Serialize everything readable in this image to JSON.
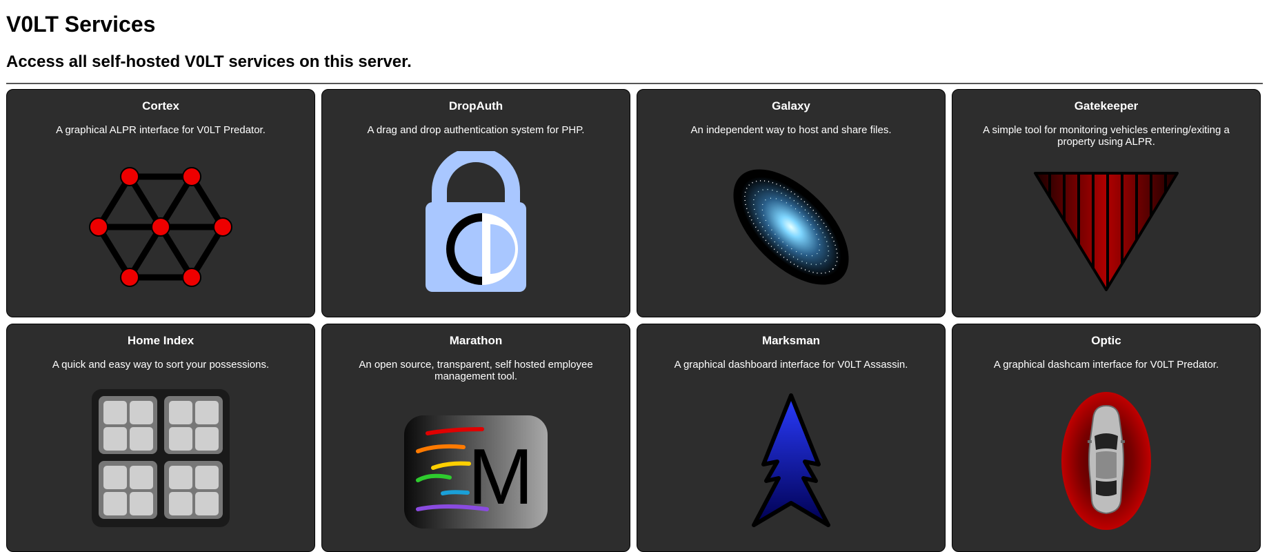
{
  "page": {
    "title": "V0LT Services",
    "subtitle": "Access all self-hosted V0LT services on this server."
  },
  "services": [
    {
      "name": "Cortex",
      "description": "A graphical ALPR interface for V0LT Predator.",
      "icon": "cortex-network-icon"
    },
    {
      "name": "DropAuth",
      "description": "A drag and drop authentication system for PHP.",
      "icon": "padlock-icon"
    },
    {
      "name": "Galaxy",
      "description": "An independent way to host and share files.",
      "icon": "galaxy-icon"
    },
    {
      "name": "Gatekeeper",
      "description": "A simple tool for monitoring vehicles entering/exiting a property using ALPR.",
      "icon": "gate-triangle-icon"
    },
    {
      "name": "Home Index",
      "description": "A quick and easy way to sort your possessions.",
      "icon": "grid-boxes-icon"
    },
    {
      "name": "Marathon",
      "description": "An open source, transparent, self hosted employee management tool.",
      "icon": "marathon-m-icon"
    },
    {
      "name": "Marksman",
      "description": "A graphical dashboard interface for V0LT Assassin.",
      "icon": "arrow-tree-icon"
    },
    {
      "name": "Optic",
      "description": "A graphical dashcam interface for V0LT Predator.",
      "icon": "car-top-view-icon"
    }
  ],
  "colors": {
    "card_background": "#2d2d2d",
    "cortex_node": "#ee0000",
    "dropauth_lock": "#a9c7ff",
    "optic_ring": "#b00000",
    "marksman_blue": "#0018ff"
  }
}
